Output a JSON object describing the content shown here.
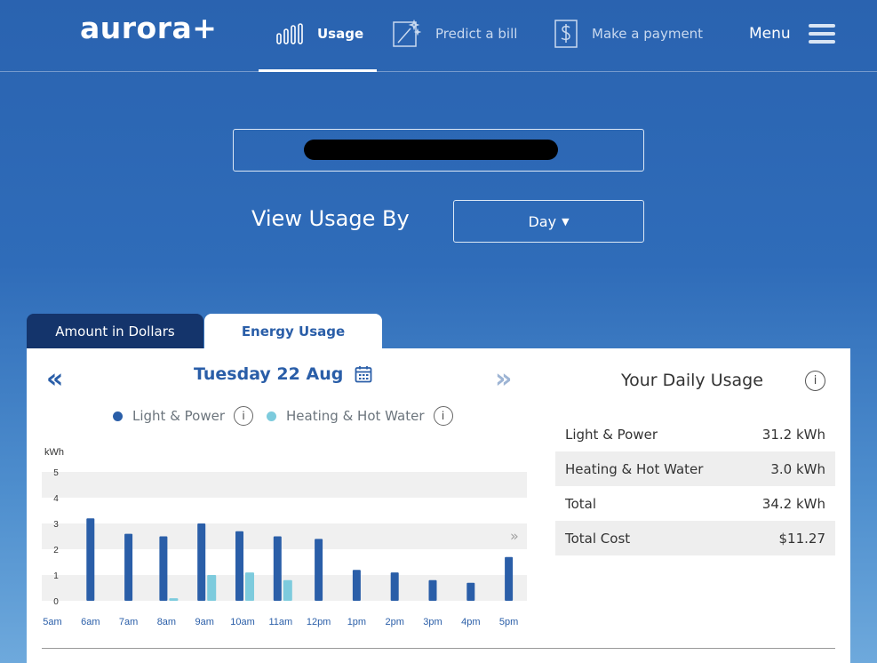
{
  "brand": {
    "logo": "aurora+"
  },
  "nav": {
    "usage": "Usage",
    "predict": "Predict a bill",
    "payment": "Make a payment",
    "menu": "Menu"
  },
  "controls": {
    "view_label": "View Usage By",
    "period": "Day"
  },
  "tabs": {
    "dollars": "Amount in Dollars",
    "energy": "Energy Usage"
  },
  "date": "Tuesday 22 Aug",
  "legend": {
    "light": "Light & Power",
    "heating": "Heating & Hot Water"
  },
  "colors": {
    "light_power": "#2a5ea8",
    "heating": "#7dcbdd",
    "accent": "#2a5ea8"
  },
  "chart_data": {
    "type": "bar",
    "ylabel": "kWh",
    "ylim": [
      0,
      5
    ],
    "yticks": [
      "0",
      "1",
      "2",
      "3",
      "4",
      "5"
    ],
    "categories": [
      "5am",
      "6am",
      "7am",
      "8am",
      "9am",
      "10am",
      "11am",
      "12pm",
      "1pm",
      "2pm",
      "3pm",
      "4pm",
      "5pm"
    ],
    "series": [
      {
        "name": "Light & Power",
        "color": "#2a5ea8",
        "values": [
          0,
          3.2,
          2.6,
          2.5,
          3.0,
          2.7,
          2.5,
          2.4,
          1.2,
          1.1,
          0.8,
          0.7,
          1.7
        ]
      },
      {
        "name": "Heating & Hot Water",
        "color": "#7dcbdd",
        "values": [
          0,
          0,
          0,
          0.1,
          1.0,
          1.1,
          0.8,
          0,
          0,
          0,
          0,
          0,
          0
        ]
      }
    ]
  },
  "daily_usage": {
    "title": "Your Daily Usage",
    "rows": [
      {
        "label": "Light & Power",
        "value": "31.2 kWh"
      },
      {
        "label": "Heating & Hot Water",
        "value": "3.0 kWh"
      },
      {
        "label": "Total",
        "value": "34.2 kWh"
      },
      {
        "label": "Total Cost",
        "value": "$11.27"
      }
    ]
  }
}
